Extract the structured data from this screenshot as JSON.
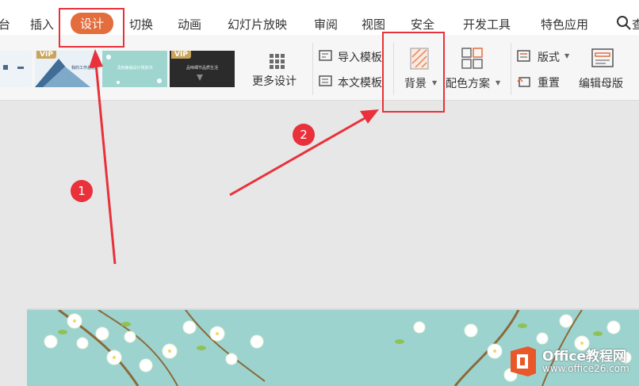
{
  "tabs": [
    {
      "id": "partial",
      "label": "台"
    },
    {
      "id": "insert",
      "label": "插入"
    },
    {
      "id": "design",
      "label": "设计"
    },
    {
      "id": "transition",
      "label": "切换"
    },
    {
      "id": "animation",
      "label": "动画"
    },
    {
      "id": "slideshow",
      "label": "幻灯片放映"
    },
    {
      "id": "review",
      "label": "审阅"
    },
    {
      "id": "view",
      "label": "视图"
    },
    {
      "id": "security",
      "label": "安全"
    },
    {
      "id": "devtools",
      "label": "开发工具"
    },
    {
      "id": "special",
      "label": "特色应用"
    },
    {
      "id": "search",
      "label": "查"
    }
  ],
  "templates": {
    "vip_label": "VIP",
    "thumb2_text": "我的工作总结",
    "thumb3_text": "清色静谧设计规划书",
    "thumb4_text": "品味细节品质生活",
    "more_label": "更多设计"
  },
  "ribbon": {
    "import_template": "导入模板",
    "text_template": "本文模板",
    "background": "背景",
    "color_scheme": "配色方案",
    "layout": "版式",
    "reset": "重置",
    "edit_master": "编辑母版"
  },
  "annotations": {
    "step1": "1",
    "step2": "2",
    "accent": "#e8313a"
  },
  "watermark": {
    "title": "Office教程网",
    "url": "www.office26.com"
  }
}
